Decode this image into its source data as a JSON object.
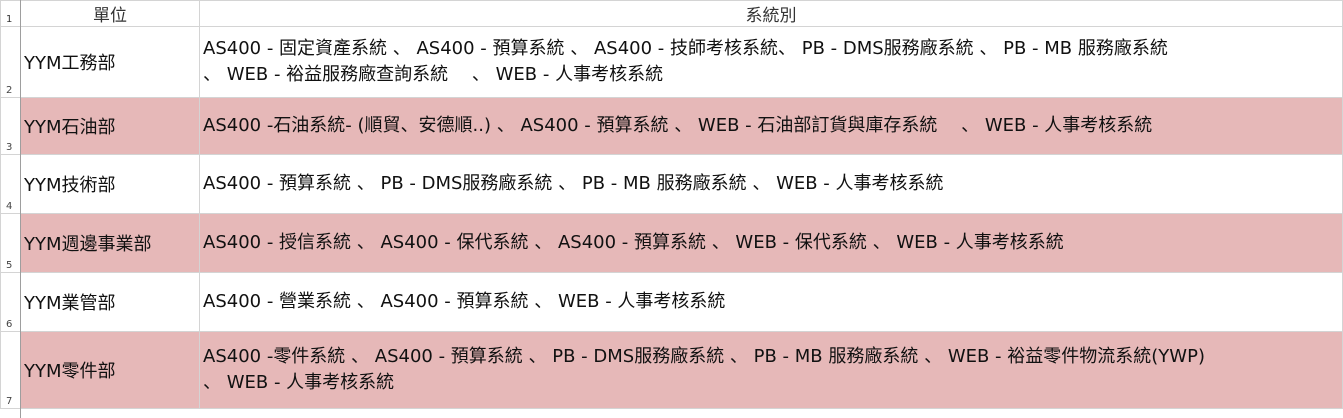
{
  "header": {
    "row_number": "1",
    "col_a": "單位",
    "col_b": "系統別"
  },
  "rows": [
    {
      "num": "2",
      "unit": "YYM工務部",
      "line1": "AS400 - 固定資產系統 、 AS400 - 預算系統 、 AS400 - 技師考核系統、 PB - DMS服務廠系統 、 PB - MB 服務廠系統",
      "line2": "、 WEB - 裕益服務廠查詢系統 　、 WEB - 人事考核系統"
    },
    {
      "num": "3",
      "unit": "YYM石油部",
      "line1": "AS400 -石油系統- (順貿、安德順..) 、 AS400 - 預算系統 、 WEB - 石油部訂貨與庫存系統 　、 WEB - 人事考核系統",
      "line2": ""
    },
    {
      "num": "4",
      "unit": "YYM技術部",
      "line1": "AS400 - 預算系統 、 PB - DMS服務廠系統 、 PB - MB 服務廠系統 、 WEB - 人事考核系統",
      "line2": ""
    },
    {
      "num": "5",
      "unit": "YYM週邊事業部",
      "line1": "AS400 - 授信系統 、 AS400 - 保代系統 、 AS400 - 預算系統 、 WEB - 保代系統 、 WEB - 人事考核系統",
      "line2": ""
    },
    {
      "num": "6",
      "unit": "YYM業管部",
      "line1": "AS400 - 營業系統 、 AS400 - 預算系統 、 WEB - 人事考核系統",
      "line2": ""
    },
    {
      "num": "7",
      "unit": "YYM零件部",
      "line1": "AS400 -零件系統 、 AS400 - 預算系統 、 PB - DMS服務廠系統 、 PB - MB 服務廠系統 、 WEB - 裕益零件物流系統(YWP)",
      "line2": "、 WEB - 人事考核系統"
    }
  ],
  "colors": {
    "highlight": "#e6b8b8",
    "gridline": "#d4d4d4"
  }
}
